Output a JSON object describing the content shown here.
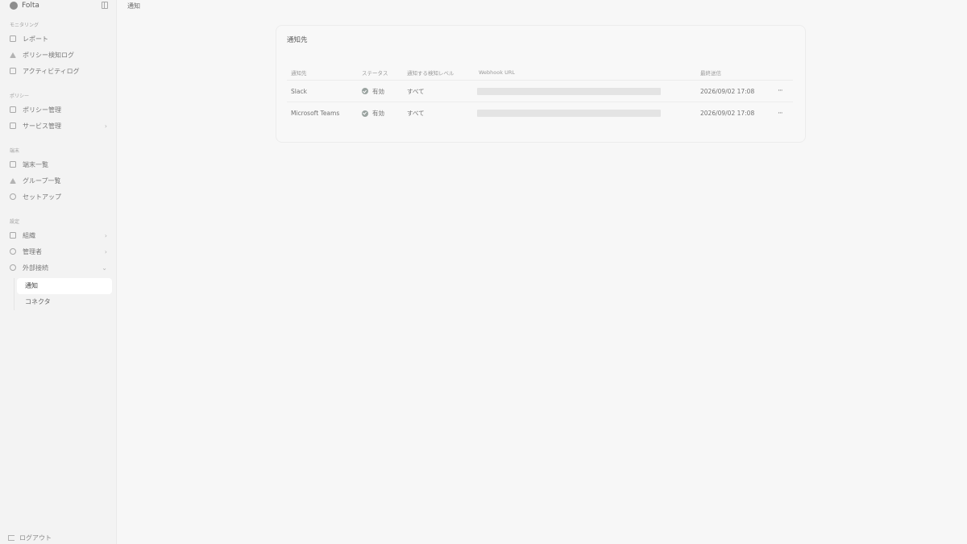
{
  "app": {
    "name": "Folta"
  },
  "sidebar": {
    "sections": [
      {
        "heading": "モニタリング",
        "items": [
          {
            "label": "レポート",
            "icon": "report-icon"
          },
          {
            "label": "ポリシー検知ログ",
            "icon": "alert-icon"
          },
          {
            "label": "アクティビティログ",
            "icon": "activity-icon"
          }
        ]
      },
      {
        "heading": "ポリシー",
        "items": [
          {
            "label": "ポリシー管理",
            "icon": "shield-icon"
          },
          {
            "label": "サービス管理",
            "icon": "server-icon",
            "chevron": "›"
          }
        ]
      },
      {
        "heading": "端末",
        "items": [
          {
            "label": "端末一覧",
            "icon": "monitor-icon"
          },
          {
            "label": "グループ一覧",
            "icon": "group-icon"
          },
          {
            "label": "セットアップ",
            "icon": "wrench-icon"
          }
        ]
      },
      {
        "heading": "設定",
        "items": [
          {
            "label": "組織",
            "icon": "building-icon",
            "chevron": "›"
          },
          {
            "label": "管理者",
            "icon": "admin-icon",
            "chevron": "›"
          },
          {
            "label": "外部接続",
            "icon": "plug-icon",
            "chevron": "⌄"
          }
        ]
      }
    ],
    "subnav": [
      {
        "label": "通知",
        "active": true
      },
      {
        "label": "コネクタ",
        "active": false
      }
    ],
    "logout": "ログアウト"
  },
  "page": {
    "title": "通知"
  },
  "card": {
    "title": "通知先",
    "columns": [
      "通知先",
      "ステータス",
      "通知する検知レベル",
      "Webhook URL",
      "最終送信",
      ""
    ],
    "rows": [
      {
        "name": "Slack",
        "status": "有効",
        "level": "すべて",
        "last_sent": "2026/09/02 17:08",
        "more": "···"
      },
      {
        "name": "Microsoft Teams",
        "status": "有効",
        "level": "すべて",
        "last_sent": "2026/09/02 17:08",
        "more": "···"
      }
    ]
  }
}
